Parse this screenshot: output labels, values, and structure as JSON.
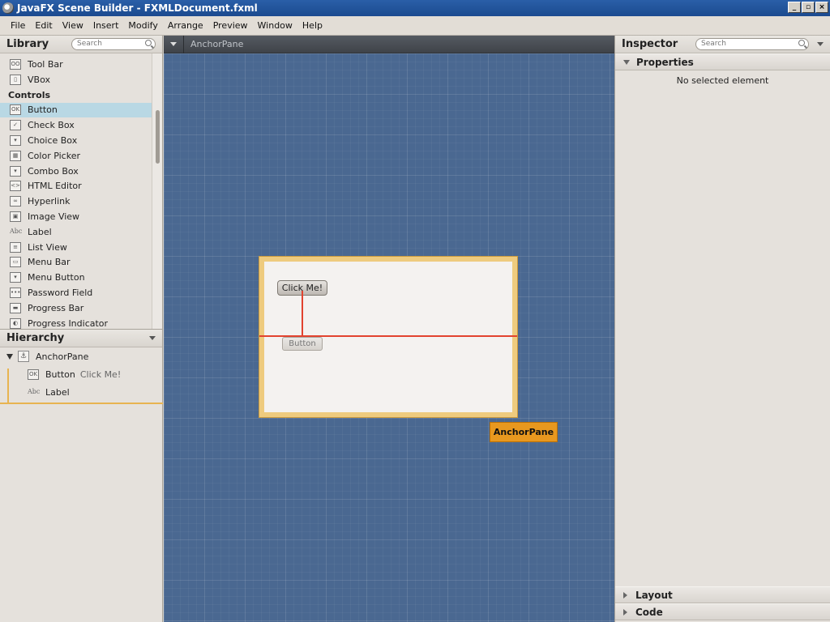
{
  "window": {
    "title": "JavaFX Scene Builder - FXMLDocument.fxml",
    "controls": [
      "_",
      "▫",
      "×"
    ]
  },
  "menu": [
    "File",
    "Edit",
    "View",
    "Insert",
    "Modify",
    "Arrange",
    "Preview",
    "Window",
    "Help"
  ],
  "library": {
    "title": "Library",
    "search_placeholder": "Search",
    "items": [
      {
        "label": "Tool Bar",
        "icon": "OO"
      },
      {
        "label": "VBox",
        "icon": "▯"
      }
    ],
    "category": "Controls",
    "controls": [
      {
        "label": "Button",
        "icon": "OK",
        "selected": true
      },
      {
        "label": "Check Box",
        "icon": "✓"
      },
      {
        "label": "Choice Box",
        "icon": "▾"
      },
      {
        "label": "Color Picker",
        "icon": "▦"
      },
      {
        "label": "Combo Box",
        "icon": "▾"
      },
      {
        "label": "HTML Editor",
        "icon": "<>"
      },
      {
        "label": "Hyperlink",
        "icon": "∞"
      },
      {
        "label": "Image View",
        "icon": "▣"
      },
      {
        "label": "Label",
        "icon": "Abc"
      },
      {
        "label": "List View",
        "icon": "≡"
      },
      {
        "label": "Menu Bar",
        "icon": "▭"
      },
      {
        "label": "Menu Button",
        "icon": "▾"
      },
      {
        "label": "Password Field",
        "icon": "•••"
      },
      {
        "label": "Progress Bar",
        "icon": "▬"
      },
      {
        "label": "Progress Indicator",
        "icon": "◐"
      }
    ]
  },
  "hierarchy": {
    "title": "Hierarchy",
    "root": {
      "label": "AnchorPane",
      "icon": "⚓"
    },
    "children": [
      {
        "type": "Button",
        "icon": "OK",
        "text": "Click Me!"
      },
      {
        "type": "Label",
        "icon": "Abc",
        "text": ""
      }
    ]
  },
  "canvas": {
    "breadcrumb": "AnchorPane",
    "button_text": "Click Me!",
    "ghost_button_text": "Button",
    "pane_tag": "AnchorPane"
  },
  "inspector": {
    "title": "Inspector",
    "search_placeholder": "Search",
    "properties_label": "Properties",
    "empty_text": "No selected element",
    "layout_label": "Layout",
    "code_label": "Code"
  }
}
